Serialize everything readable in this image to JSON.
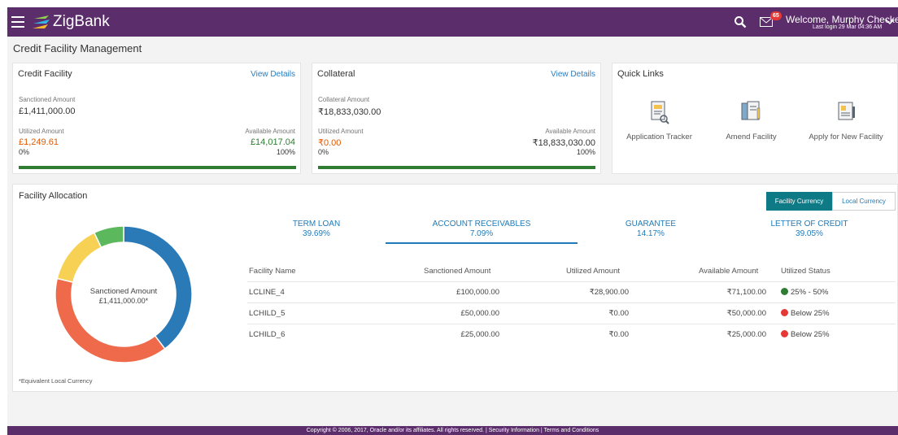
{
  "header": {
    "brand": "ZigBank",
    "notification_count": "65",
    "welcome": "Welcome, Murphy Checker",
    "last_login": "Last login 29 Mar 04:36 AM"
  },
  "page": {
    "title": "Credit Facility Management"
  },
  "credit_facility": {
    "title": "Credit Facility",
    "view_details": "View Details",
    "sanctioned_label": "Sanctioned Amount",
    "sanctioned_value": "£1,411,000.00",
    "utilized_label": "Utilized Amount",
    "utilized_value": "£1,249.61",
    "available_label": "Available Amount",
    "available_value": "£14,017.04",
    "min_pct": "0%",
    "max_pct": "100%"
  },
  "collateral": {
    "title": "Collateral",
    "view_details": "View Details",
    "amount_label": "Collateral Amount",
    "amount_value": "₹18,833,030.00",
    "utilized_label": "Utilized Amount",
    "utilized_value": "₹0.00",
    "available_label": "Available Amount",
    "available_value": "₹18,833,030.00",
    "min_pct": "0%",
    "max_pct": "100%"
  },
  "quick_links": {
    "title": "Quick Links",
    "items": [
      {
        "label": "Application Tracker",
        "icon": "document-search-icon"
      },
      {
        "label": "Amend Facility",
        "icon": "document-edit-icon"
      },
      {
        "label": "Apply for New Facility",
        "icon": "document-apply-icon"
      }
    ]
  },
  "allocation": {
    "title": "Facility Allocation",
    "toggle": {
      "facility_currency": "Facility Currency",
      "local_currency": "Local Currency",
      "active": "facility_currency"
    },
    "donut": {
      "label": "Sanctioned Amount",
      "value": "£1,411,000.00*"
    },
    "footnote": "*Equivalent Local Currency",
    "tabs": [
      {
        "name": "TERM LOAN",
        "pct": "39.69%"
      },
      {
        "name": "ACCOUNT RECEIVABLES",
        "pct": "7.09%",
        "active": true
      },
      {
        "name": "GUARANTEE",
        "pct": "14.17%"
      },
      {
        "name": "LETTER OF CREDIT",
        "pct": "39.05%"
      }
    ],
    "table": {
      "headers": [
        "Facility Name",
        "Sanctioned Amount",
        "Utilized Amount",
        "Available Amount",
        "Utilized Status"
      ],
      "rows": [
        {
          "name": "LCLINE_4",
          "sanctioned": "£100,000.00",
          "utilized": "₹28,900.00",
          "available": "₹71,100.00",
          "status": "25% - 50%",
          "status_color": "#2e7d32"
        },
        {
          "name": "LCHILD_5",
          "sanctioned": "£50,000.00",
          "utilized": "₹0.00",
          "available": "₹50,000.00",
          "status": "Below 25%",
          "status_color": "#e53935"
        },
        {
          "name": "LCHILD_6",
          "sanctioned": "£25,000.00",
          "utilized": "₹0.00",
          "available": "₹25,000.00",
          "status": "Below 25%",
          "status_color": "#e53935"
        }
      ]
    }
  },
  "chart_data": {
    "type": "pie",
    "categories": [
      "TERM LOAN",
      "LETTER OF CREDIT",
      "GUARANTEE",
      "ACCOUNT RECEIVABLES"
    ],
    "values": [
      39.69,
      39.05,
      14.17,
      7.09
    ],
    "colors": [
      "#2a7ab8",
      "#ef6a4a",
      "#f7d154",
      "#5cb85c"
    ]
  },
  "footer": {
    "text": "Copyright © 2006, 2017, Oracle and/or its affiliates. All rights reserved. | Security Information | Terms and Conditions"
  }
}
